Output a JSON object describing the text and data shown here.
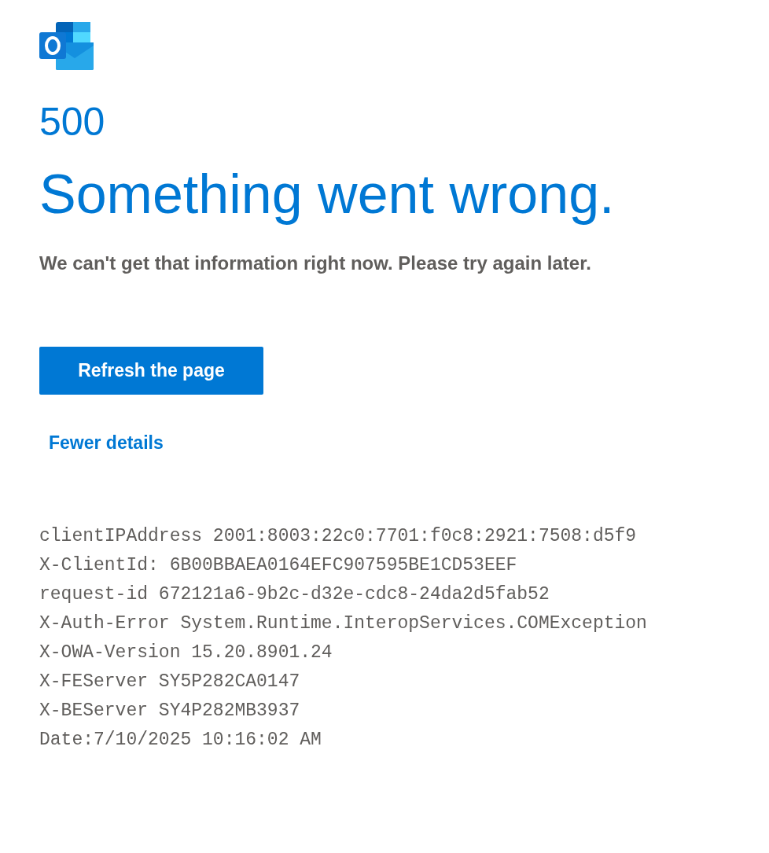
{
  "error_code": "500",
  "heading": "Something went wrong.",
  "message": "We can't get that information right now. Please try again later.",
  "button": "Refresh the page",
  "details_link": "Fewer details",
  "details": [
    "clientIPAddress 2001:8003:22c0:7701:f0c8:2921:7508:d5f9",
    "X-ClientId: 6B00BBAEA0164EFC907595BE1CD53EEF",
    "request-id 672121a6-9b2c-d32e-cdc8-24da2d5fab52",
    "X-Auth-Error System.Runtime.InteropServices.COMException",
    "X-OWA-Version 15.20.8901.24",
    "X-FEServer SY5P282CA0147",
    "X-BEServer SY4P282MB3937",
    "Date:7/10/2025 10:16:02 AM"
  ]
}
